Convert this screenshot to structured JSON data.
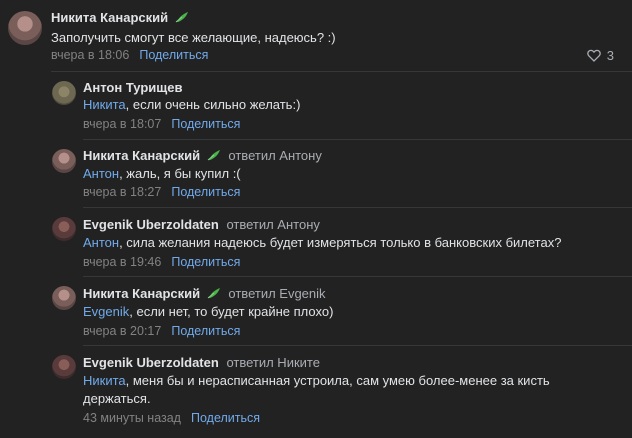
{
  "comments": [
    {
      "author": "Никита Канарский",
      "mention": "",
      "text": "Заполучить смогут все желающие, надеюсь? :)",
      "time": "вчера в 18:06",
      "share_label": "Поделиться",
      "likes": "3"
    },
    {
      "author": "Антон Турищев",
      "mention": "Никита",
      "text": ", если очень сильно желать:)",
      "time": "вчера в 18:07",
      "share_label": "Поделиться"
    },
    {
      "author": "Никита Канарский",
      "replied_to": "ответил Антону",
      "mention": "Антон",
      "text": ", жаль, я бы купил :(",
      "time": "вчера в 18:27",
      "share_label": "Поделиться"
    },
    {
      "author": "Evgenik Uberzoldaten",
      "replied_to": "ответил Антону",
      "mention": "Антон",
      "text": ", сила желания надеюсь будет измеряться только в банковских билетах?",
      "time": "вчера в 19:46",
      "share_label": "Поделиться"
    },
    {
      "author": "Никита Канарский",
      "replied_to": "ответил Evgenik",
      "mention": "Evgenik",
      "text": ", если нет, то будет крайне плохо)",
      "time": "вчера в 20:17",
      "share_label": "Поделиться"
    },
    {
      "author": "Evgenik Uberzoldaten",
      "replied_to": "ответил Никите",
      "mention": "Никита",
      "text": ", меня бы и нерасписанная устроила, сам умею более-менее за кисть держаться.",
      "time": "43 минуты назад",
      "share_label": "Поделиться"
    }
  ],
  "colors": {
    "background": "#222222",
    "link": "#71aaeb",
    "muted": "#828282",
    "text": "#e1e3e6",
    "leaf": "#4bb34b"
  },
  "icons": {
    "leaf": "leaf-icon",
    "heart": "heart-icon"
  }
}
